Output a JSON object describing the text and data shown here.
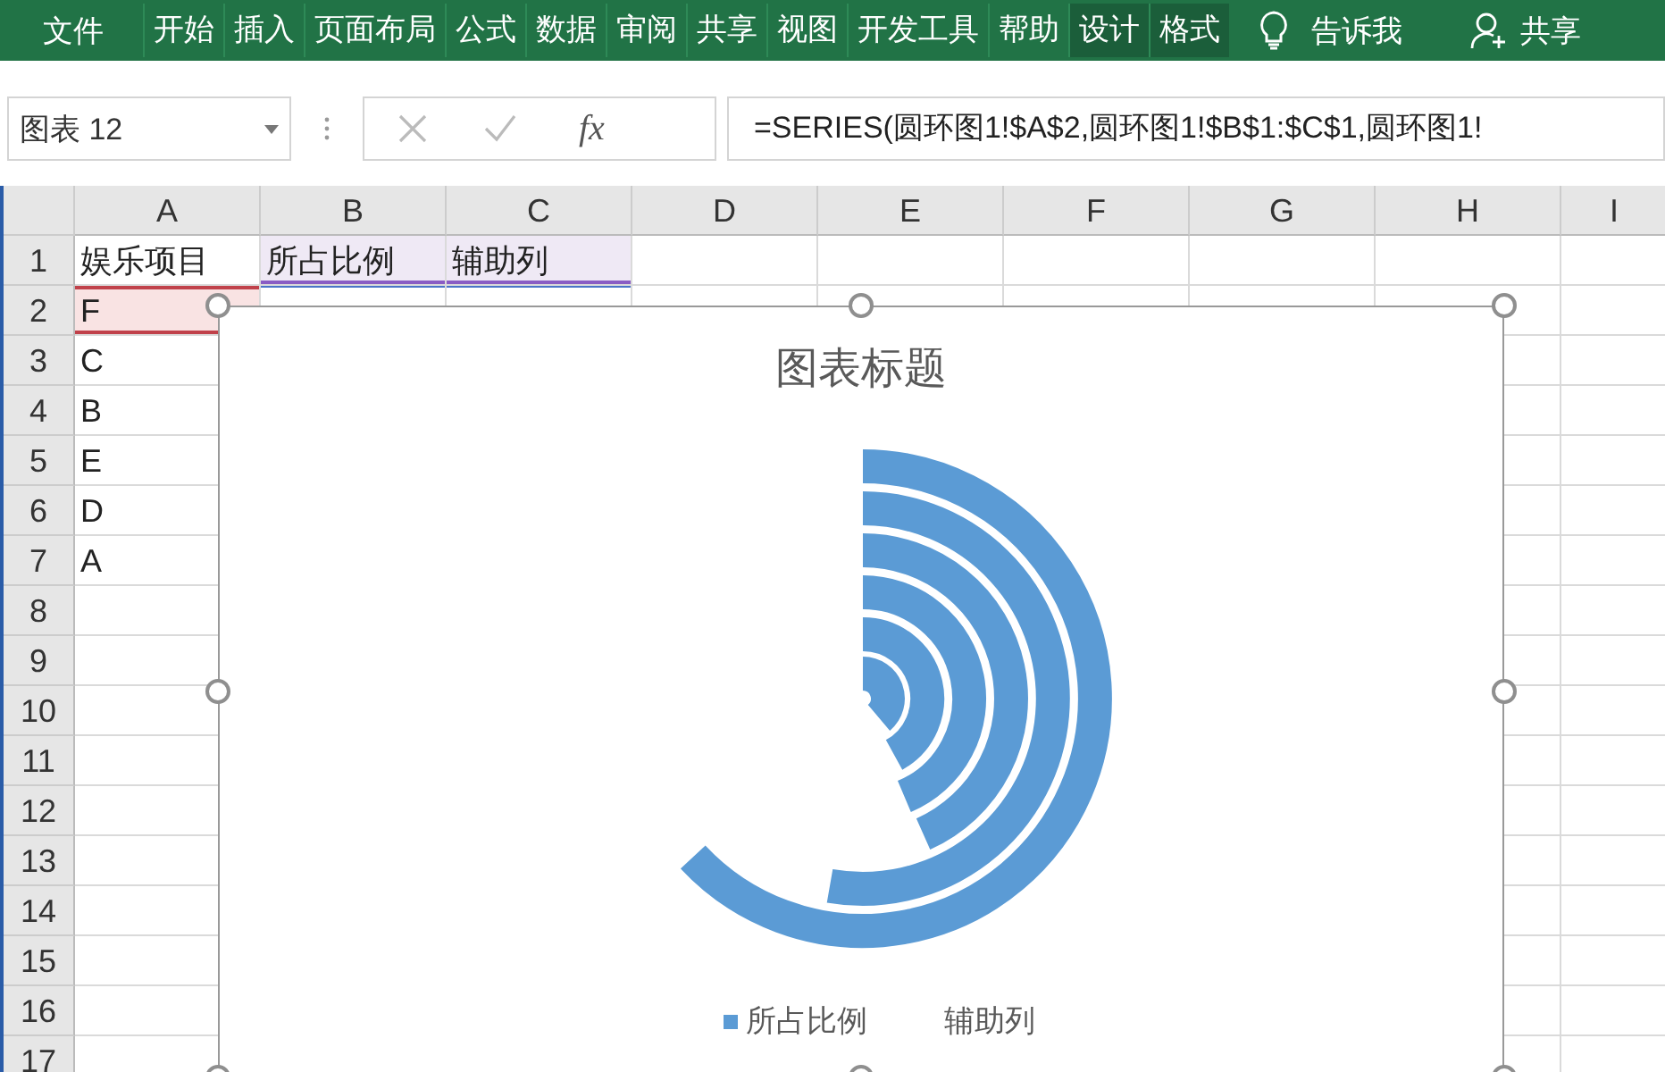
{
  "ribbon": {
    "file_tab": "文件",
    "tabs": [
      {
        "label": "开始",
        "contextual": false
      },
      {
        "label": "插入",
        "contextual": false
      },
      {
        "label": "页面布局",
        "contextual": false
      },
      {
        "label": "公式",
        "contextual": false
      },
      {
        "label": "数据",
        "contextual": false
      },
      {
        "label": "审阅",
        "contextual": false
      },
      {
        "label": "共享",
        "contextual": false
      },
      {
        "label": "视图",
        "contextual": false
      },
      {
        "label": "开发工具",
        "contextual": false
      },
      {
        "label": "帮助",
        "contextual": false
      },
      {
        "label": "设计",
        "contextual": true
      },
      {
        "label": "格式",
        "contextual": true
      }
    ],
    "tell_me": "告诉我",
    "share": "共享"
  },
  "formula_bar": {
    "name_box": "图表 12",
    "fx": "fx",
    "formula": "=SERIES(圆环图1!$A$2,圆环图1!$B$1:$C$1,圆环图1!"
  },
  "sheet": {
    "columns": [
      "A",
      "B",
      "C",
      "D",
      "E",
      "F",
      "G",
      "H",
      "I"
    ],
    "rows": [
      {
        "number": "1",
        "cells": [
          {
            "text": "娱乐项目"
          },
          {
            "text": "所占比例",
            "kind": "categories"
          },
          {
            "text": "辅助列",
            "kind": "categories"
          }
        ]
      },
      {
        "number": "2",
        "cells": [
          {
            "text": "F",
            "kind": "name"
          },
          {
            "kind": "values"
          },
          {
            "kind": "values"
          }
        ]
      },
      {
        "number": "3",
        "cells": [
          {
            "text": "C"
          }
        ]
      },
      {
        "number": "4",
        "cells": [
          {
            "text": "B"
          }
        ]
      },
      {
        "number": "5",
        "cells": [
          {
            "text": "E"
          }
        ]
      },
      {
        "number": "6",
        "cells": [
          {
            "text": "D"
          }
        ]
      },
      {
        "number": "7",
        "cells": [
          {
            "text": "A"
          }
        ]
      },
      {
        "number": "8",
        "cells": []
      },
      {
        "number": "9",
        "cells": []
      },
      {
        "number": "10",
        "cells": []
      },
      {
        "number": "11",
        "cells": []
      },
      {
        "number": "12",
        "cells": []
      },
      {
        "number": "13",
        "cells": []
      },
      {
        "number": "14",
        "cells": []
      },
      {
        "number": "15",
        "cells": []
      },
      {
        "number": "16",
        "cells": []
      },
      {
        "number": "17",
        "cells": []
      }
    ]
  },
  "chart": {
    "title": "图表标题",
    "selected": true,
    "legend": [
      {
        "label": "所占比例",
        "color": "#5b9bd5"
      },
      {
        "label": "辅助列"
      }
    ]
  }
}
